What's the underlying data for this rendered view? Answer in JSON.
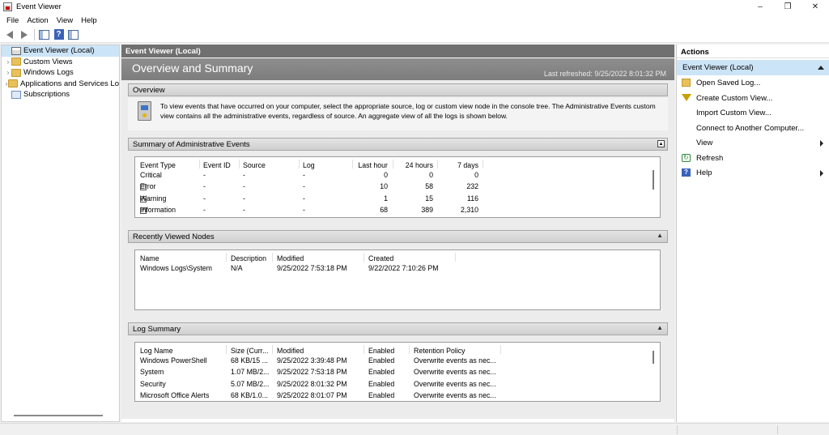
{
  "window": {
    "title": "Event Viewer",
    "minimize": "–",
    "maximize": "❐",
    "close": "✕"
  },
  "menu": [
    "File",
    "Action",
    "View",
    "Help"
  ],
  "tree": {
    "items": [
      {
        "label": "Event Viewer (Local)",
        "selected": true
      },
      {
        "label": "Custom Views"
      },
      {
        "label": "Windows Logs"
      },
      {
        "label": "Applications and Services Lo"
      },
      {
        "label": "Subscriptions"
      }
    ]
  },
  "center": {
    "header": "Event Viewer (Local)",
    "banner_title": "Overview and Summary",
    "last_refreshed": "Last refreshed: 9/25/2022 8:01:32 PM"
  },
  "overview": {
    "title": "Overview",
    "text": "To view events that have occurred on your computer, select the appropriate source, log or custom view node in the console tree. The Administrative Events custom view contains all the administrative events, regardless of source. An aggregate view of all the logs is shown below."
  },
  "admin_summary": {
    "title": "Summary of Administrative Events",
    "collapse": "▲",
    "columns": [
      "Event Type",
      "Event ID",
      "Source",
      "Log",
      "Last hour",
      "24 hours",
      "7 days"
    ],
    "rows": [
      {
        "type": "Critical",
        "expander": "",
        "event_id": "-",
        "source": "-",
        "log": "-",
        "last_hour": "0",
        "h24": "0",
        "d7": "0"
      },
      {
        "type": "Error",
        "expander": "+",
        "event_id": "-",
        "source": "-",
        "log": "-",
        "last_hour": "10",
        "h24": "58",
        "d7": "232"
      },
      {
        "type": "Warning",
        "expander": "+",
        "event_id": "-",
        "source": "-",
        "log": "-",
        "last_hour": "1",
        "h24": "15",
        "d7": "116"
      },
      {
        "type": "Information",
        "expander": "+",
        "event_id": "-",
        "source": "-",
        "log": "-",
        "last_hour": "68",
        "h24": "389",
        "d7": "2,310"
      }
    ]
  },
  "recent_nodes": {
    "title": "Recently Viewed Nodes",
    "collapse": "▲",
    "columns": [
      "Name",
      "Description",
      "Modified",
      "Created"
    ],
    "rows": [
      {
        "name": "Windows Logs\\System",
        "description": "N/A",
        "modified": "9/25/2022 7:53:18 PM",
        "created": "9/22/2022 7:10:26 PM"
      }
    ]
  },
  "log_summary": {
    "title": "Log Summary",
    "collapse": "▲",
    "columns": [
      "Log Name",
      "Size (Curr...",
      "Modified",
      "Enabled",
      "Retention Policy"
    ],
    "rows": [
      {
        "name": "Windows PowerShell",
        "size": "68 KB/15 ...",
        "modified": "9/25/2022 3:39:48 PM",
        "enabled": "Enabled",
        "policy": "Overwrite events as nec..."
      },
      {
        "name": "System",
        "size": "1.07 MB/2...",
        "modified": "9/25/2022 7:53:18 PM",
        "enabled": "Enabled",
        "policy": "Overwrite events as nec..."
      },
      {
        "name": "Security",
        "size": "5.07 MB/2...",
        "modified": "9/25/2022 8:01:32 PM",
        "enabled": "Enabled",
        "policy": "Overwrite events as nec..."
      },
      {
        "name": "Microsoft Office Alerts",
        "size": "68 KB/1.0...",
        "modified": "9/25/2022 8:01:07 PM",
        "enabled": "Enabled",
        "policy": "Overwrite events as nec..."
      }
    ]
  },
  "actions": {
    "header": "Actions",
    "group": "Event Viewer (Local)",
    "items": [
      {
        "label": "Open Saved Log...",
        "icon": "folder-open-icon"
      },
      {
        "label": "Create Custom View...",
        "icon": "filter-icon"
      },
      {
        "label": "Import Custom View...",
        "icon": ""
      },
      {
        "label": "Connect to Another Computer...",
        "icon": ""
      },
      {
        "label": "View",
        "icon": "",
        "submenu": true
      },
      {
        "label": "Refresh",
        "icon": "refresh-icon"
      },
      {
        "label": "Help",
        "icon": "help-icon",
        "submenu": true
      }
    ]
  },
  "colors": {
    "selection": "#cce4f7",
    "header_gray": "#707070",
    "help_blue": "#3a62b8"
  }
}
